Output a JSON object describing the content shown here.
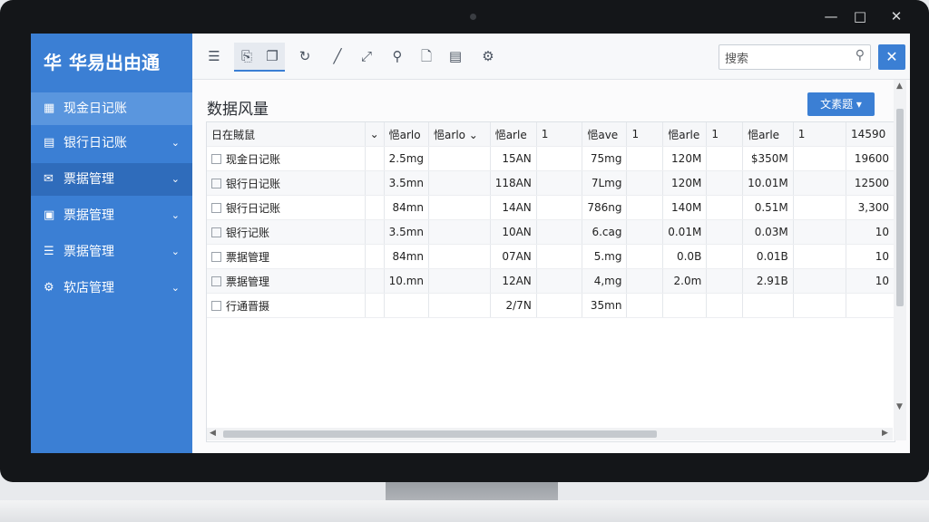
{
  "app": {
    "logo_glyph": "华",
    "title": "华易出由通"
  },
  "window": {
    "minimize": "—",
    "maximize": "□",
    "close": "✕"
  },
  "sidebar": {
    "items": [
      {
        "label": "现金日记账",
        "icon": "grid-icon",
        "glyph": "▦",
        "active": true,
        "chevron": ""
      },
      {
        "label": "银行日记账",
        "icon": "list-icon",
        "glyph": "▤",
        "chevron": "⌄"
      },
      {
        "label": "票据管理",
        "icon": "envelope-icon",
        "glyph": "✉",
        "chevron": "⌄"
      },
      {
        "label": "票据管理",
        "icon": "document-icon",
        "glyph": "▣",
        "chevron": "⌄"
      },
      {
        "label": "票据管理",
        "icon": "form-icon",
        "glyph": "☰",
        "chevron": "⌄"
      },
      {
        "label": "软店管理",
        "icon": "gear-icon",
        "glyph": "⚙",
        "chevron": "⌄"
      }
    ]
  },
  "toolbar": {
    "buttons": [
      {
        "name": "list-icon",
        "glyph": "☰"
      },
      {
        "name": "clipboard-icon",
        "glyph": "⎘"
      },
      {
        "name": "copy-icon",
        "glyph": "❐"
      },
      {
        "name": "refresh-icon",
        "glyph": "↻"
      },
      {
        "name": "pencil-icon",
        "glyph": "╱"
      },
      {
        "name": "expand-icon",
        "glyph": "⤢"
      },
      {
        "name": "search-icon",
        "glyph": "⚲"
      },
      {
        "name": "file-icon",
        "glyph": "🗋"
      },
      {
        "name": "report-icon",
        "glyph": "▤"
      },
      {
        "name": "settings-icon",
        "glyph": "⚙"
      }
    ],
    "search_placeholder": "搜索",
    "close_label": "✕"
  },
  "content": {
    "title": "数据风量",
    "action_button": "文素题 ▾"
  },
  "table": {
    "headers": [
      "日在賊鼠",
      "⌄",
      "悒arlo",
      "悒arlo ⌄",
      "悒arle",
      "1",
      "悒ave",
      "1",
      "悒arle",
      "1",
      "悒arle",
      "1",
      "14590"
    ],
    "rows": [
      [
        "现金日记账",
        "",
        "2.5mg",
        "",
        "15AN",
        "",
        "75mg",
        "",
        "120M",
        "",
        "$350M",
        "",
        "19600"
      ],
      [
        "银行日记账",
        "",
        "3.5mn",
        "",
        "118AN",
        "",
        "7Lmg",
        "",
        "120M",
        "",
        "10.01M",
        "",
        "12500"
      ],
      [
        "银行日记账",
        "",
        "84mn",
        "",
        "14AN",
        "",
        "786ng",
        "",
        "140M",
        "",
        "0.51M",
        "",
        "3,300"
      ],
      [
        "银行记账",
        "",
        "3.5mn",
        "",
        "10AN",
        "",
        "6.cag",
        "",
        "0.01M",
        "",
        "0.03M",
        "",
        "10"
      ],
      [
        "票据管理",
        "",
        "84mn",
        "",
        "07AN",
        "",
        "5.mg",
        "",
        "0.0B",
        "",
        "0.01B",
        "",
        "10"
      ],
      [
        "票据管理",
        "",
        "10.mn",
        "",
        "12AN",
        "",
        "4,mg",
        "",
        "2.0m",
        "",
        "2.91B",
        "",
        "10"
      ],
      [
        "行通晋摄",
        "",
        "",
        "",
        "2/7N",
        "",
        "35mn",
        "",
        "",
        "",
        "",
        "",
        ""
      ]
    ]
  },
  "colors": {
    "accent": "#3b7fd4",
    "sidebar_bg": "#3b7fd4"
  }
}
